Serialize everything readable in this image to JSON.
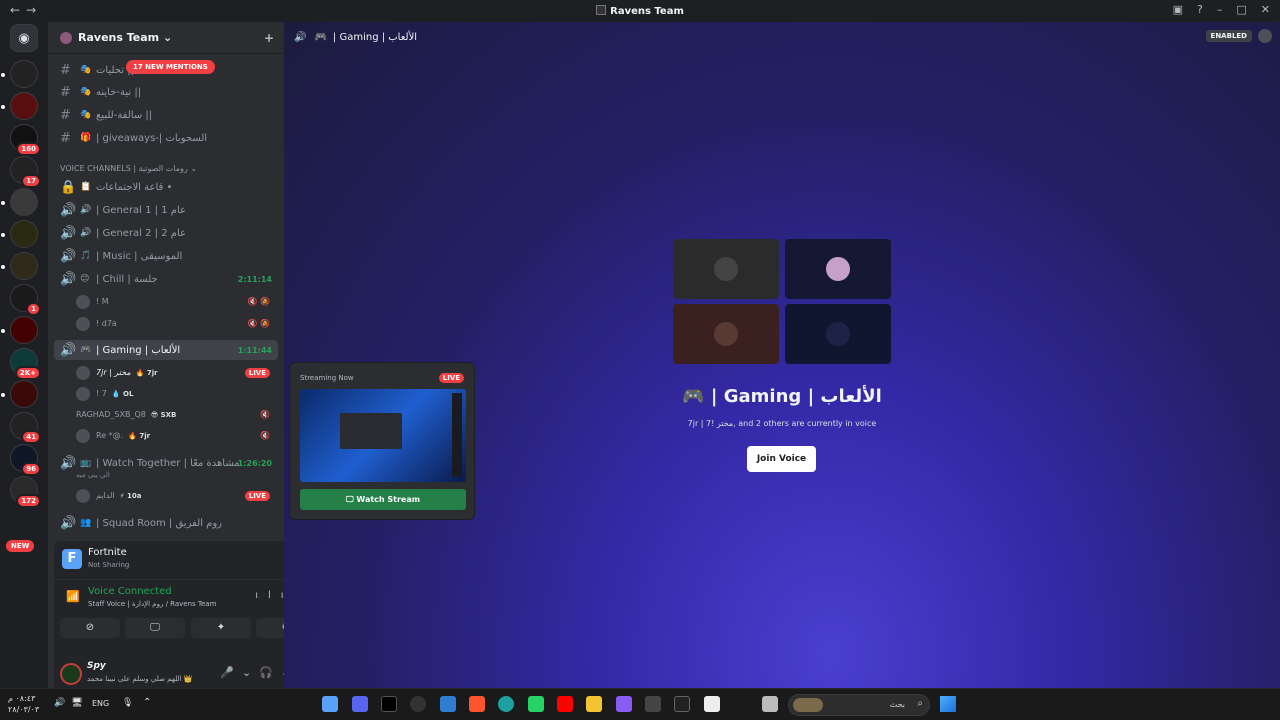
{
  "titlebar": {
    "back": "←",
    "forward": "→",
    "title": "Ravens Team"
  },
  "guilds": {
    "badges": [
      "160",
      "17",
      "1",
      "2K+",
      "41",
      "96",
      "172"
    ],
    "new_label": "NEW"
  },
  "server": {
    "name": "Ravens Team",
    "chevron": "⌄",
    "add_user": "+"
  },
  "mention_pill": "17 NEW MENTIONS",
  "text_channels": [
    {
      "name": "تحليات ||",
      "emoji": "🎭"
    },
    {
      "name": "نية-خاينه ||",
      "emoji": "🎭"
    },
    {
      "name": "سالفة-للبيع ||",
      "emoji": "🎭"
    },
    {
      "name": "| giveaways-| السحوبات",
      "emoji": "🎁"
    }
  ],
  "category": "VOICE CHANNELS | رومات الصوتية",
  "voice_channels": [
    {
      "name": "قاعة الاجتماعات •",
      "icon": "🔒",
      "emoji": "📋",
      "time": ""
    },
    {
      "name": "| General 1 | عام 1",
      "icon": "🔊",
      "emoji": "🔊",
      "time": ""
    },
    {
      "name": "| General 2 | عام 2",
      "icon": "🔊",
      "emoji": "🔊",
      "time": ""
    },
    {
      "name": "| Music | الموسيقى",
      "icon": "🔊",
      "emoji": "🎵",
      "time": ""
    },
    {
      "name": "| Chill | جلسة",
      "icon": "🔊",
      "emoji": "😊",
      "time": "2:11:14"
    },
    {
      "name": "| Gaming | الألعاب",
      "icon": "🔊",
      "emoji": "🎮",
      "time": "1:11:44"
    },
    {
      "name": "| Watch Together | مشاهدة معًا",
      "icon": "🔊",
      "emoji": "📺",
      "time": "1:26:20"
    },
    {
      "name": "| Squad Room | روم الفريق",
      "icon": "🔊",
      "emoji": "👥",
      "time": ""
    }
  ],
  "chill_users": [
    {
      "name": "! M"
    },
    {
      "name": "! d7a"
    }
  ],
  "gaming_users": [
    {
      "name": "7jr | مختر",
      "tag": "🔥 7jr",
      "live": "LIVE"
    },
    {
      "name": "! 7",
      "tag": "💧 OL",
      "live": ""
    },
    {
      "name": "RAGHAD_SXB_Q8",
      "tag": "😎 SXB",
      "live": ""
    },
    {
      "name": "Re *@.",
      "tag": "🔥 7jr",
      "live": ""
    }
  ],
  "watch_users": [
    {
      "name": "الدايم",
      "tag": "⚡ 10a",
      "live": "LIVE"
    }
  ],
  "watch_sub": "الي يبي ميه",
  "game_activity": {
    "letter": "F",
    "title": "Fortnite",
    "status": "Not Sharing"
  },
  "voice_connected": {
    "title": "Voice Connected",
    "sub": "Staff Voice | روم الإدارة / Ravens Team"
  },
  "account": {
    "name": "Spy",
    "status": "اللهم صلي وسلم على نبينا محمد 👑"
  },
  "main_header": {
    "channel": "| Gaming | الألعاب",
    "enabled": "ENABLED"
  },
  "voice_title": "🎮 | Gaming | الألعاب",
  "voice_sub": "7jr | 7! مختر, and 2 others are currently in voice",
  "join_label": "Join Voice",
  "popup": {
    "header": "Streaming Now",
    "live": "LIVE",
    "watch": "Watch Stream"
  },
  "taskbar": {
    "time": "٠٨:٤٣ م",
    "date": "٢٨/٠٣/٠٣",
    "lang": "ENG",
    "search": "بحث"
  },
  "colors": {
    "accent_green": "#23a55a",
    "live_red": "#f23f43",
    "bg_main": "#2b2d31"
  }
}
